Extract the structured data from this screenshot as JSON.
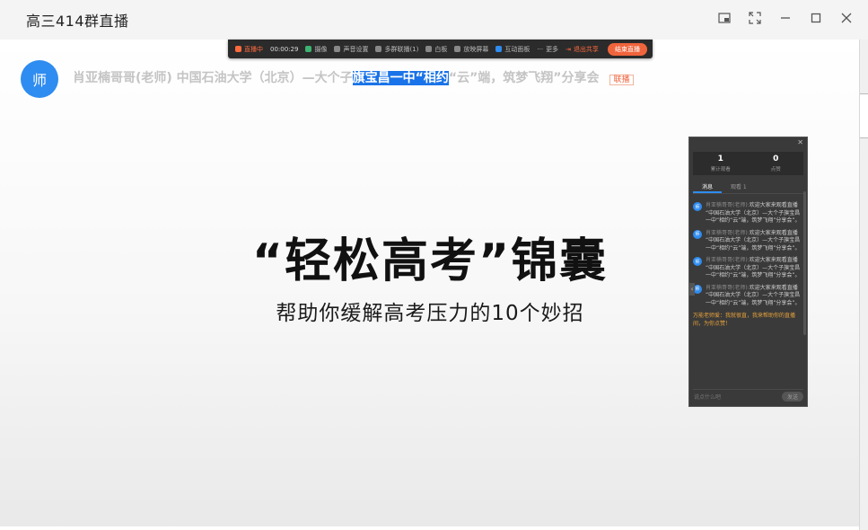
{
  "window": {
    "title": "高三414群直播"
  },
  "toolbar": {
    "live_label": "直播中",
    "time": "00:00:29",
    "items": [
      "摄像",
      "声音设置",
      "多群联播(1)",
      "白板",
      "放映屏幕",
      "互动面板",
      "更多"
    ],
    "exit_label": "退出共享",
    "end_label": "结束直播"
  },
  "host": {
    "avatar_text": "师",
    "topic_before": "肖亚楠哥哥(老师) 中国石油大学（北京）—大个子",
    "topic_selected": "旗宝昌一中“相约",
    "topic_after": "“云”端，筑梦飞翔”分享会",
    "tag": "联播"
  },
  "slide": {
    "headline": "“轻松高考”锦囊",
    "subline": "帮助你缓解高考压力的10个妙招"
  },
  "panel": {
    "stats": [
      {
        "value": "1",
        "label": "累计观看"
      },
      {
        "value": "0",
        "label": "点赞"
      }
    ],
    "tabs": [
      "消息",
      "观看 1"
    ],
    "messages": [
      {
        "avatar": "师",
        "who": "肖亚楠哥哥(老师):",
        "text": "欢迎大家来观看直播 “中国石油大学（北京）—大个子旗宝昌一中“相约“云”端，筑梦飞翔”分享会”。"
      },
      {
        "avatar": "师",
        "who": "肖亚楠哥哥(老师):",
        "text": "欢迎大家来观看直播 “中国石油大学（北京）—大个子旗宝昌一中“相约“云”端，筑梦飞翔”分享会”。"
      },
      {
        "avatar": "师",
        "who": "肖亚楠哥哥(老师):",
        "text": "欢迎大家来观看直播 “中国石油大学（北京）—大个子旗宝昌一中“相约“云”端，筑梦飞翔”分享会”。"
      },
      {
        "avatar": "师",
        "who": "肖亚楠哥哥(老师):",
        "text": "欢迎大家来观看直播 “中国石油大学（北京）—大个子旗宝昌一中“相约“云”端，筑梦飞翔”分享会”。"
      }
    ],
    "notice": "万能老师爱：我就很直，我来帮助你的直播间，为你点赞！",
    "input_placeholder": "说点什么吧",
    "send_label": "发送"
  }
}
